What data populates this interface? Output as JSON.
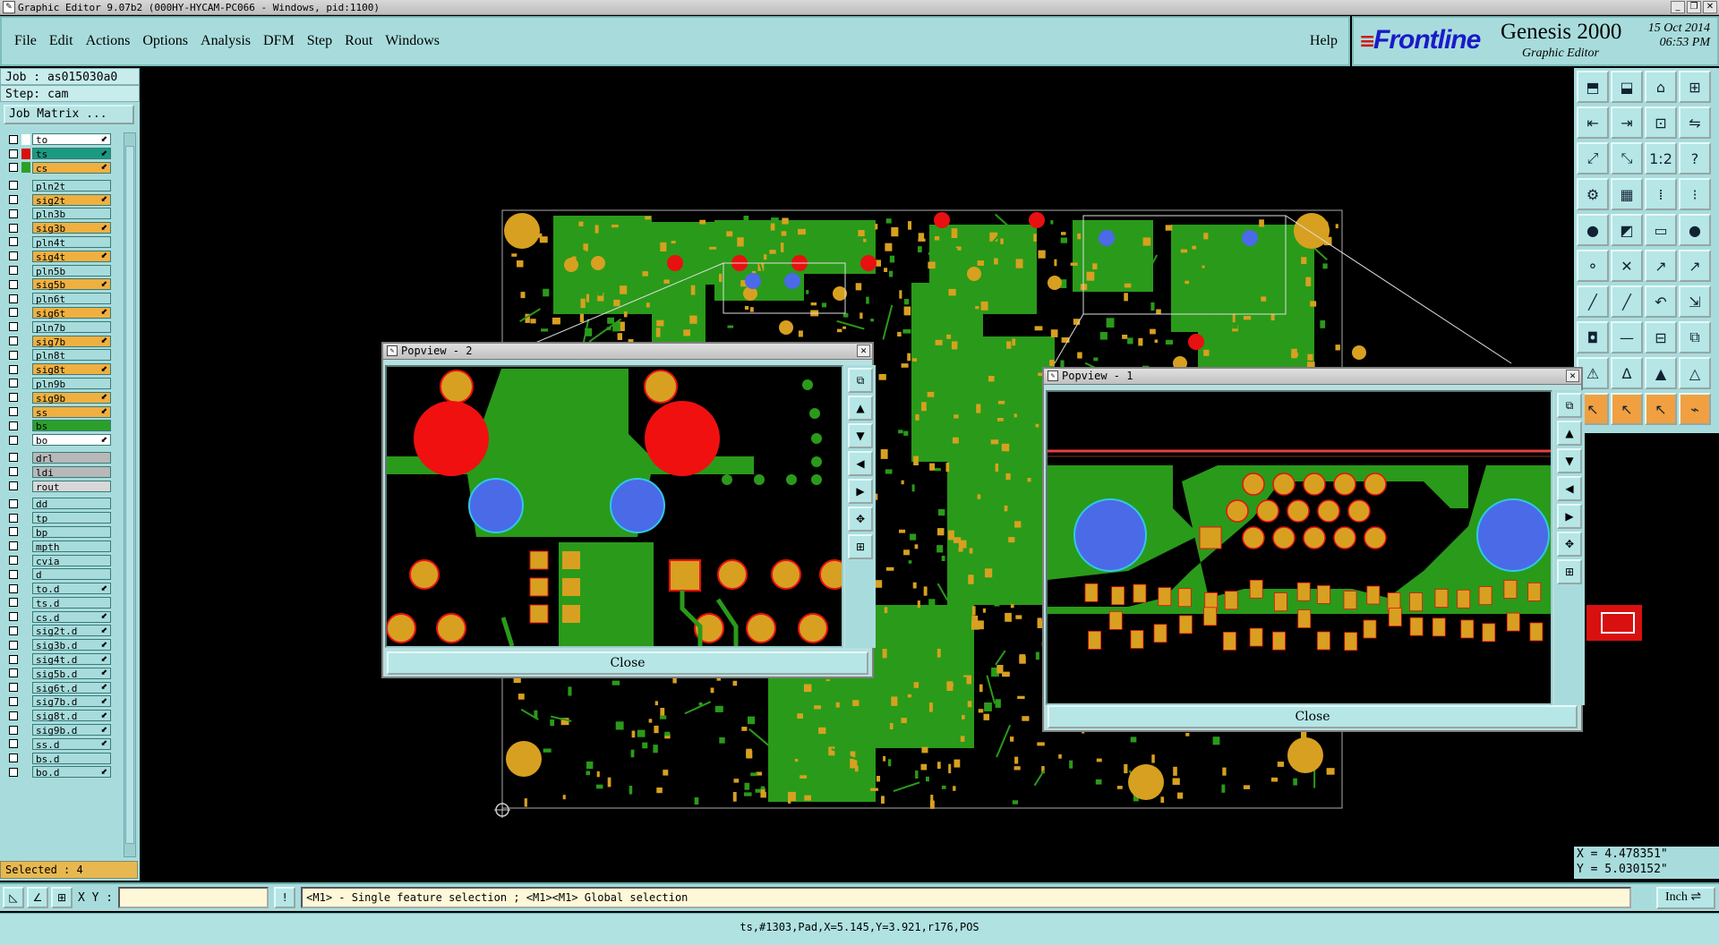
{
  "window": {
    "title": "Graphic Editor 9.07b2 (000HY-HYCAM-PC066 - Windows, pid:1100)"
  },
  "menu": {
    "items": [
      "File",
      "Edit",
      "Actions",
      "Options",
      "Analysis",
      "DFM",
      "Step",
      "Rout",
      "Windows"
    ],
    "help": "Help"
  },
  "brand": {
    "logo": "Frontline",
    "product": "Genesis 2000",
    "subtitle": "Graphic Editor",
    "date": "15 Oct 2014",
    "time": "06:53 PM"
  },
  "job": {
    "job_line": "Job : as015030a0",
    "step_line": "Step: cam",
    "matrix_button": "Job Matrix ..."
  },
  "layers": [
    {
      "name": "to",
      "color": "#ffffff",
      "arrow": true,
      "swatch": "#ffffff"
    },
    {
      "name": "ts",
      "color": "#1a9a80",
      "arrow": true,
      "swatch": "#d81010",
      "work": true
    },
    {
      "name": "cs",
      "color": "#f0b040",
      "arrow": true,
      "swatch": "#2aa02a"
    },
    {
      "gap": true
    },
    {
      "name": "pln2t",
      "color": "#a8dcdc"
    },
    {
      "name": "sig2t",
      "color": "#f0b040",
      "arrow": true
    },
    {
      "name": "pln3b",
      "color": "#a8dcdc"
    },
    {
      "name": "sig3b",
      "color": "#f0b040",
      "arrow": true
    },
    {
      "name": "pln4t",
      "color": "#a8dcdc"
    },
    {
      "name": "sig4t",
      "color": "#f0b040",
      "arrow": true
    },
    {
      "name": "pln5b",
      "color": "#a8dcdc"
    },
    {
      "name": "sig5b",
      "color": "#f0b040",
      "arrow": true
    },
    {
      "name": "pln6t",
      "color": "#a8dcdc"
    },
    {
      "name": "sig6t",
      "color": "#f0b040",
      "arrow": true
    },
    {
      "name": "pln7b",
      "color": "#a8dcdc"
    },
    {
      "name": "sig7b",
      "color": "#f0b040",
      "arrow": true
    },
    {
      "name": "pln8t",
      "color": "#a8dcdc"
    },
    {
      "name": "sig8t",
      "color": "#f0b040",
      "arrow": true
    },
    {
      "name": "pln9b",
      "color": "#a8dcdc"
    },
    {
      "name": "sig9b",
      "color": "#f0b040",
      "arrow": true
    },
    {
      "name": "ss",
      "color": "#f0b040",
      "arrow": true
    },
    {
      "name": "bs",
      "color": "#2aa02a"
    },
    {
      "name": "bo",
      "color": "#ffffff",
      "arrow": true
    },
    {
      "gap": true
    },
    {
      "name": "drl",
      "color": "#b8b8b8"
    },
    {
      "name": "ldi",
      "color": "#b8b8b8"
    },
    {
      "name": "rout",
      "color": "#d8d8d8"
    },
    {
      "gap": true
    },
    {
      "name": "dd",
      "color": "#a8dcdc"
    },
    {
      "name": "tp",
      "color": "#a8dcdc"
    },
    {
      "name": "bp",
      "color": "#a8dcdc"
    },
    {
      "name": "mpth",
      "color": "#a8dcdc"
    },
    {
      "name": "cvia",
      "color": "#a8dcdc"
    },
    {
      "name": "d",
      "color": "#a8dcdc"
    },
    {
      "name": "to.d",
      "color": "#a8dcdc",
      "arrow": true
    },
    {
      "name": "ts.d",
      "color": "#a8dcdc"
    },
    {
      "name": "cs.d",
      "color": "#a8dcdc",
      "arrow": true
    },
    {
      "name": "sig2t.d",
      "color": "#a8dcdc",
      "arrow": true
    },
    {
      "name": "sig3b.d",
      "color": "#a8dcdc",
      "arrow": true
    },
    {
      "name": "sig4t.d",
      "color": "#a8dcdc",
      "arrow": true
    },
    {
      "name": "sig5b.d",
      "color": "#a8dcdc",
      "arrow": true
    },
    {
      "name": "sig6t.d",
      "color": "#a8dcdc",
      "arrow": true
    },
    {
      "name": "sig7b.d",
      "color": "#a8dcdc",
      "arrow": true
    },
    {
      "name": "sig8t.d",
      "color": "#a8dcdc",
      "arrow": true
    },
    {
      "name": "sig9b.d",
      "color": "#a8dcdc",
      "arrow": true
    },
    {
      "name": "ss.d",
      "color": "#a8dcdc",
      "arrow": true
    },
    {
      "name": "bs.d",
      "color": "#a8dcdc"
    },
    {
      "name": "bo.d",
      "color": "#a8dcdc",
      "arrow": true
    }
  ],
  "selection": {
    "label": "Selected : 4"
  },
  "popview2": {
    "title": "Popview - 2",
    "close_label": "Close"
  },
  "popview1": {
    "title": "Popview - 1",
    "close_label": "Close"
  },
  "toolbar": {
    "icons": [
      "layer-open-icon",
      "layer-save-icon",
      "home-icon",
      "window-split-icon",
      "pan-left-icon",
      "pan-right-icon",
      "zoom-area-icon",
      "swap-icon",
      "zoom-fit-icon",
      "zoom-center-icon",
      "scale-icon",
      "help-icon",
      "pcb-icon",
      "grid-icon",
      "snap-icon",
      "snap-center-icon",
      "pad-add-icon",
      "line-add-icon",
      "measure-icon",
      "dot-icon",
      "connect-icon",
      "delete-icon",
      "move-icon",
      "copy-icon",
      "edit-line-icon",
      "slash-icon",
      "undo-arc-icon",
      "resize-icon",
      "pad-select-icon",
      "line-select-icon",
      "array-icon",
      "layers-icon",
      "warning-icon",
      "polygon-icon",
      "polygon-fill-icon",
      "polygon-outline-icon",
      "pointer-icon",
      "select-arrow-icon",
      "select-plus-icon",
      "route-icon"
    ],
    "scale_text": "1:2",
    "help_text": "?"
  },
  "coords": {
    "x_line": "X = 4.478351\"",
    "y_line": "Y = 5.030152\""
  },
  "bottombar": {
    "xy_label": "X Y :",
    "xy_value": "",
    "message": "<M1> - Single feature selection ; <M1><M1> Global selection",
    "unit": "Inch"
  },
  "status": {
    "text": "ts,#1303,Pad,X=5.145,Y=3.921,r176,POS"
  },
  "board_colors": {
    "copper": "#2a9a1a",
    "pad": "#d8a020",
    "selected": "#e81010",
    "highlight": "#4a6ae8"
  }
}
